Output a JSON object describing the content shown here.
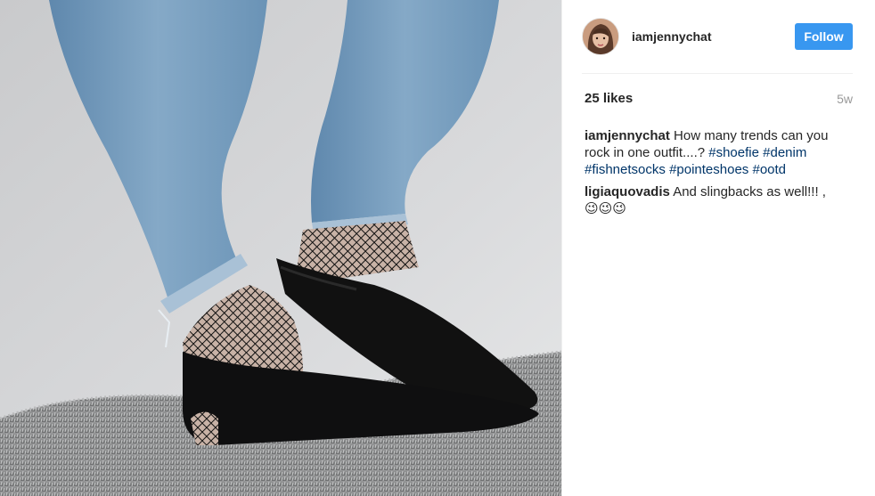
{
  "post": {
    "username": "iamjennychat",
    "follow_label": "Follow",
    "likes": "25 likes",
    "age": "5w"
  },
  "comments": [
    {
      "author": "iamjennychat",
      "text": "How many trends can you rock in one outfit....?",
      "hashtags": [
        "#shoefie",
        "#denim",
        "#fishnetsocks",
        "#pointeshoes",
        "#ootd"
      ]
    },
    {
      "author": "ligiaquovadis",
      "text": "And slingbacks as well!!! ,",
      "emoji": "😉😉😉"
    }
  ],
  "icons": {
    "avatar": "profile-photo",
    "emoji": "winking-face"
  },
  "colors": {
    "follow_button": "#3897f0",
    "hashtag": "#003569",
    "timestamp": "#999999"
  }
}
